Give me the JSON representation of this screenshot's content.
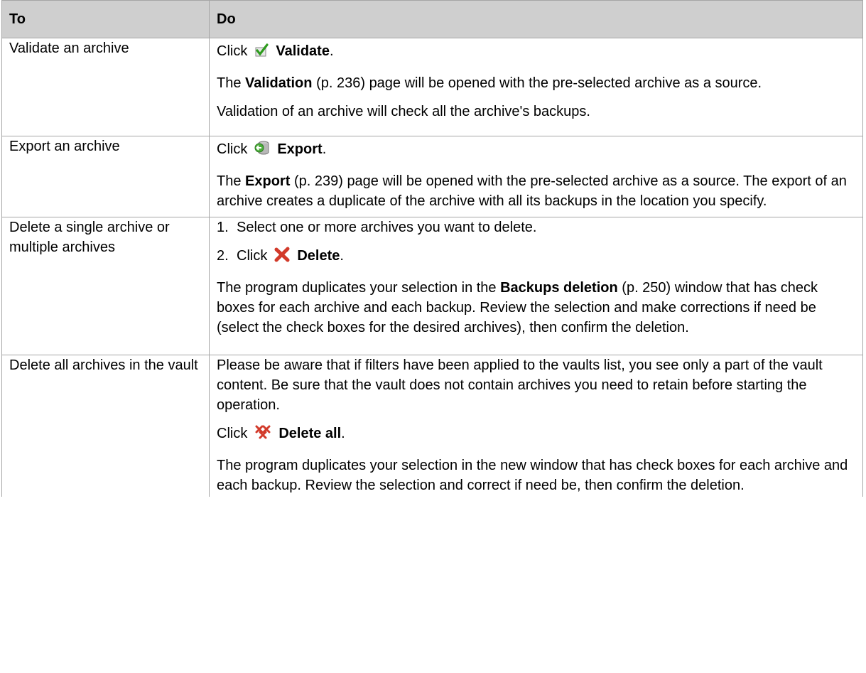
{
  "header": {
    "col1": "To",
    "col2": "Do"
  },
  "rows": [
    {
      "action": "Validate an archive",
      "click_prefix": "Click",
      "button": "Validate",
      "button_icon": "validate-checkmark-icon",
      "p1_bold": "Validation",
      "p1_ref": "(p. 236)",
      "p1_rest": "page will be opened with the pre-selected archive as a source.",
      "p2": "Validation of an archive will check all the archive's backups."
    },
    {
      "action": "Export an archive",
      "click_prefix": "Click",
      "button": "Export",
      "button_icon": "export-database-icon",
      "p1_bold": "Export",
      "p1_ref": "(p. 239)",
      "p1_rest": "page will be opened with the pre-selected archive as a source. The export of an archive creates a duplicate of the archive with all its backups in the location you specify."
    },
    {
      "action": "Delete a single archive or multiple archives",
      "step1_num": "1.",
      "step1": "Select one or more archives you want to delete.",
      "step2_num": "2.",
      "click_prefix": "Click",
      "button": "Delete",
      "button_icon": "delete-x-icon",
      "p1_pre": "The program duplicates your selection in the",
      "p1_bold": "Backups deletion",
      "p1_ref": "(p. 250)",
      "p1_rest": "window that has check boxes for each archive and each backup. Review the selection and make corrections if need be (select the check boxes for the desired archives), then confirm the deletion."
    },
    {
      "action": "Delete all archives in the vault",
      "p0": "Please be aware that if filters have been applied to the vaults list, you see only a part of the vault content. Be sure that the vault does not contain archives you need to retain before starting the operation.",
      "click_prefix": "Click",
      "button": "Delete all",
      "button_icon": "delete-all-icon",
      "p1": "The program duplicates your selection in the new window that has check boxes for each archive and each backup. Review the selection and correct if need be, then confirm the deletion."
    }
  ]
}
